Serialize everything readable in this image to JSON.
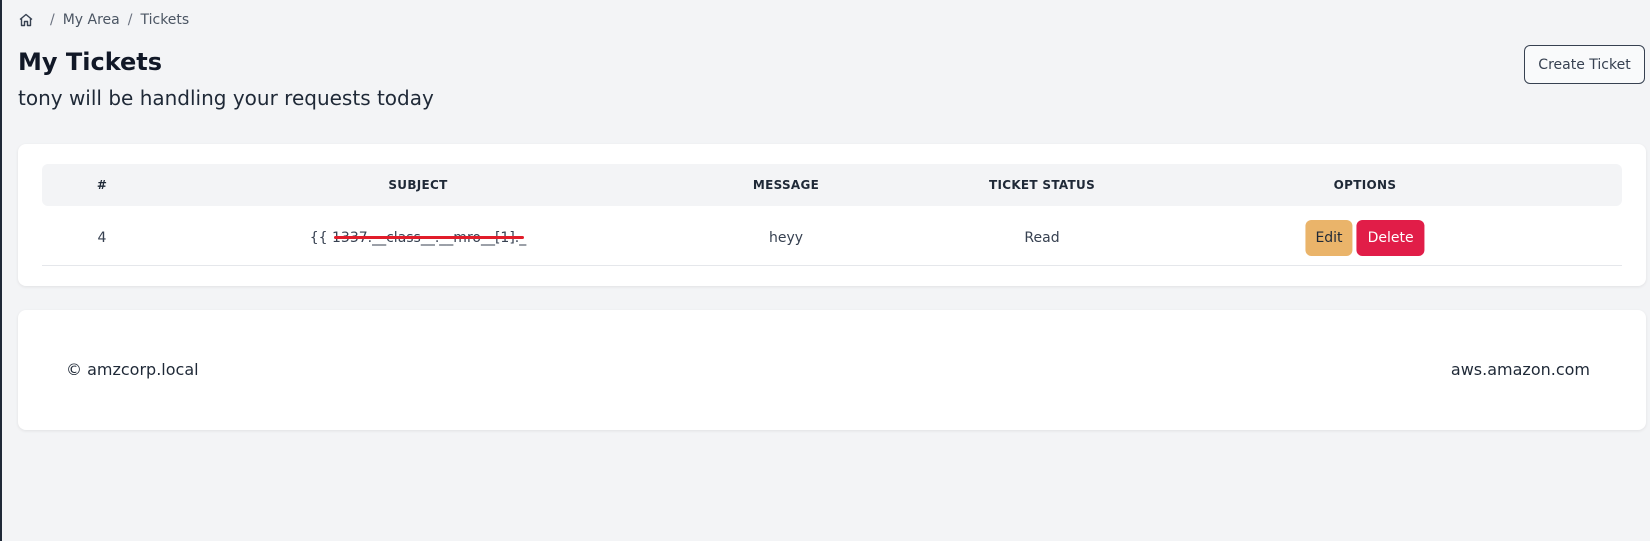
{
  "breadcrumb": {
    "items": [
      {
        "label": "My Area"
      },
      {
        "label": "Tickets"
      }
    ],
    "separator": "/"
  },
  "page": {
    "title": "My Tickets",
    "subtitle": "tony will be handling your requests today"
  },
  "actions": {
    "create_ticket_label": "Create Ticket"
  },
  "table": {
    "headers": [
      "#",
      "SUBJECT",
      "MESSAGE",
      "TICKET STATUS",
      "OPTIONS"
    ],
    "rows": [
      {
        "id": "4",
        "subject": "{{ 1337.__class__.__mro__[1]._",
        "message": "heyy",
        "status": "Read",
        "edit_label": "Edit",
        "delete_label": "Delete"
      }
    ]
  },
  "footer": {
    "left_text": "© amzcorp.local",
    "right_text": "aws.amazon.com"
  },
  "colors": {
    "edit": "#eab46a",
    "delete": "#e11d48",
    "annotation_underline": "#e11d2a"
  },
  "icons": {
    "home": "home-icon"
  }
}
